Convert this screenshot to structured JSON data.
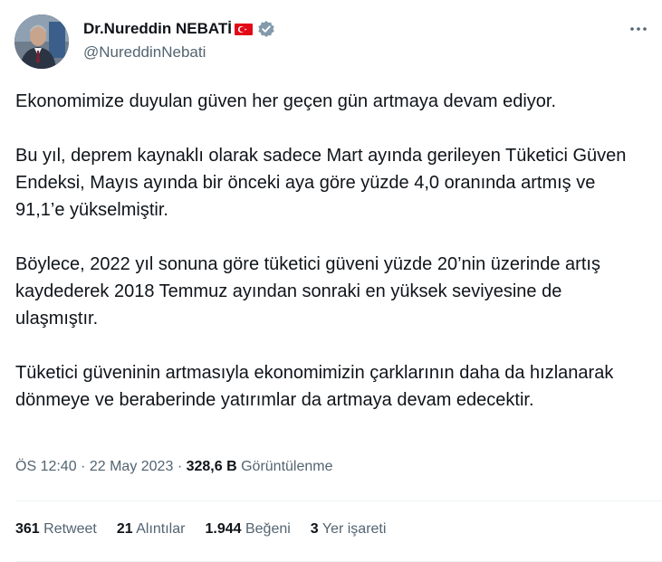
{
  "author": {
    "name": "Dr.Nureddin NEBATİ",
    "handle": "@NureddinNebati",
    "flag_icon": "turkey-flag-icon",
    "verified_icon": "gray-verified-badge-icon"
  },
  "more_icon": "more-horizontal-icon",
  "body": {
    "p1": "Ekonomimize duyulan güven her geçen gün artmaya devam ediyor.",
    "p2": "Bu yıl, deprem kaynaklı olarak sadece Mart ayında gerileyen Tüketici Güven Endeksi, Mayıs ayında bir önceki aya göre yüzde 4,0 oranında artmış ve 91,1’e yükselmiştir.",
    "p3": "Böylece, 2022 yıl sonuna göre tüketici güveni yüzde 20’nin üzerinde artış kaydederek 2018 Temmuz ayından sonraki en yüksek seviyesine de ulaşmıştır.",
    "p4": "Tüketici güveninin artmasıyla ekonomimizin çarklarının daha da hızlanarak dönmeye ve beraberinde yatırımlar da artmaya devam edecektir."
  },
  "meta": {
    "time": "ÖS 12:40",
    "sep": "·",
    "date": "22 May 2023",
    "views": "328,6 B",
    "views_label": "Görüntülenme"
  },
  "stats": {
    "retweets": "361",
    "retweets_label": "Retweet",
    "quotes": "21",
    "quotes_label": "Alıntılar",
    "likes": "1.944",
    "likes_label": "Beğeni",
    "bookmarks": "3",
    "bookmarks_label": "Yer işareti"
  },
  "colors": {
    "text": "#0f1419",
    "secondary": "#536471",
    "flag_red": "#e30a17",
    "verified_gray": "#829aab"
  }
}
